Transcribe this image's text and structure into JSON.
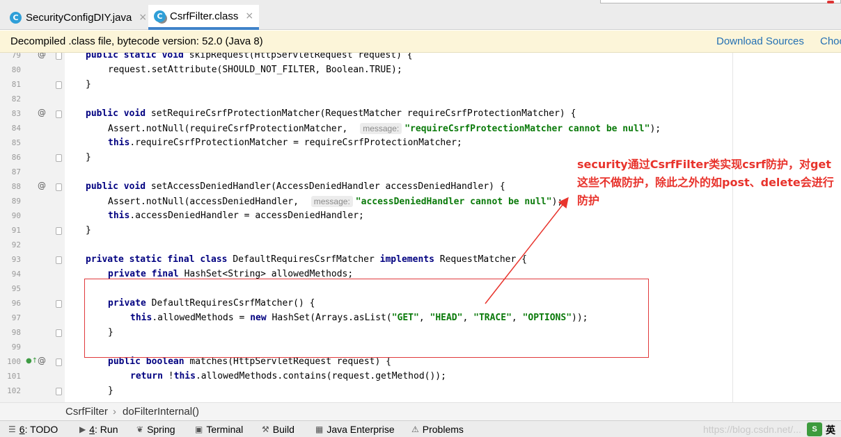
{
  "tabs": [
    {
      "icon": "class-icon",
      "label": "SecurityConfigDIY.java",
      "close": "×"
    },
    {
      "icon": "class-locked-icon",
      "label": "CsrfFilter.class",
      "close": "×"
    }
  ],
  "banner": {
    "message": "Decompiled .class file, bytecode version: 52.0 (Java 8)",
    "download_link": "Download Sources",
    "choose_link": "Choo"
  },
  "code": {
    "lines": [
      {
        "num": "79",
        "ann": "@",
        "fold": true,
        "indent": 1,
        "tokens": [
          [
            "kw",
            "public static void "
          ],
          [
            "",
            "skipRequest(HttpServletRequest request) {"
          ]
        ]
      },
      {
        "num": "80",
        "indent": 2,
        "tokens": [
          [
            "",
            "request.setAttribute(SHOULD_NOT_FILTER, Boolean.TRUE);"
          ]
        ]
      },
      {
        "num": "81",
        "fold": true,
        "indent": 1,
        "tokens": [
          [
            "",
            "}"
          ]
        ]
      },
      {
        "num": "82",
        "indent": 0,
        "tokens": []
      },
      {
        "num": "83",
        "ann": "@",
        "fold": true,
        "indent": 1,
        "tokens": [
          [
            "kw",
            "public void "
          ],
          [
            "",
            "setRequireCsrfProtectionMatcher(RequestMatcher requireCsrfProtectionMatcher) {"
          ]
        ]
      },
      {
        "num": "84",
        "indent": 2,
        "tokens": [
          [
            "",
            "Assert.notNull(requireCsrfProtectionMatcher, "
          ],
          [
            "hint",
            "message:"
          ],
          [
            "str",
            "\"requireCsrfProtectionMatcher cannot be null\""
          ],
          [
            "",
            ");"
          ]
        ]
      },
      {
        "num": "85",
        "indent": 2,
        "tokens": [
          [
            "kw",
            "this"
          ],
          [
            "",
            ".requireCsrfProtectionMatcher = requireCsrfProtectionMatcher;"
          ]
        ]
      },
      {
        "num": "86",
        "fold": true,
        "indent": 1,
        "tokens": [
          [
            "",
            "}"
          ]
        ]
      },
      {
        "num": "87",
        "indent": 0,
        "tokens": []
      },
      {
        "num": "88",
        "ann": "@",
        "fold": true,
        "indent": 1,
        "tokens": [
          [
            "kw",
            "public void "
          ],
          [
            "",
            "setAccessDeniedHandler(AccessDeniedHandler accessDeniedHandler) {"
          ]
        ]
      },
      {
        "num": "89",
        "indent": 2,
        "tokens": [
          [
            "",
            "Assert.notNull(accessDeniedHandler, "
          ],
          [
            "hint",
            "message:"
          ],
          [
            "str",
            "\"accessDeniedHandler cannot be null\""
          ],
          [
            "",
            ");"
          ]
        ]
      },
      {
        "num": "90",
        "indent": 2,
        "tokens": [
          [
            "kw",
            "this"
          ],
          [
            "",
            ".accessDeniedHandler = accessDeniedHandler;"
          ]
        ]
      },
      {
        "num": "91",
        "fold": true,
        "indent": 1,
        "tokens": [
          [
            "",
            "}"
          ]
        ]
      },
      {
        "num": "92",
        "indent": 0,
        "tokens": []
      },
      {
        "num": "93",
        "fold": true,
        "indent": 1,
        "tokens": [
          [
            "kw",
            "private static final class "
          ],
          [
            "",
            "DefaultRequiresCsrfMatcher "
          ],
          [
            "kw",
            "implements "
          ],
          [
            "",
            "RequestMatcher {"
          ]
        ]
      },
      {
        "num": "94",
        "indent": 2,
        "tokens": [
          [
            "kw",
            "private final "
          ],
          [
            "",
            "HashSet<String> allowedMethods;"
          ]
        ]
      },
      {
        "num": "95",
        "indent": 0,
        "tokens": []
      },
      {
        "num": "96",
        "fold": true,
        "indent": 2,
        "tokens": [
          [
            "kw",
            "private "
          ],
          [
            "",
            "DefaultRequiresCsrfMatcher() {"
          ]
        ]
      },
      {
        "num": "97",
        "indent": 3,
        "tokens": [
          [
            "kw",
            "this"
          ],
          [
            "",
            ".allowedMethods = "
          ],
          [
            "kw",
            "new "
          ],
          [
            "",
            "HashSet(Arrays.asList("
          ],
          [
            "str",
            "\"GET\""
          ],
          [
            "",
            ", "
          ],
          [
            "str",
            "\"HEAD\""
          ],
          [
            "",
            ", "
          ],
          [
            "str",
            "\"TRACE\""
          ],
          [
            "",
            ", "
          ],
          [
            "str",
            "\"OPTIONS\""
          ],
          [
            "",
            "));"
          ]
        ]
      },
      {
        "num": "98",
        "fold": true,
        "indent": 2,
        "tokens": [
          [
            "",
            "}"
          ]
        ]
      },
      {
        "num": "99",
        "indent": 0,
        "tokens": []
      },
      {
        "num": "100",
        "ann": "@",
        "ann2": "●↑",
        "fold": true,
        "indent": 2,
        "tokens": [
          [
            "kw",
            "public boolean "
          ],
          [
            "",
            "matches(HttpServletRequest request) {"
          ]
        ]
      },
      {
        "num": "101",
        "indent": 3,
        "tokens": [
          [
            "kw",
            "return "
          ],
          [
            "",
            "!"
          ],
          [
            "kw",
            "this"
          ],
          [
            "",
            ".allowedMethods.contains(request.getMethod());"
          ]
        ]
      },
      {
        "num": "102",
        "fold": true,
        "indent": 2,
        "tokens": [
          [
            "",
            "}"
          ]
        ]
      }
    ]
  },
  "annotation": {
    "note": "security通过CsrfFilter类实现csrf防护，对get这些不做防护，除此之外的如post、delete会进行防护",
    "color": "#e8332c"
  },
  "breadcrumb": {
    "items": [
      "CsrfFilter",
      "doFilterInternal()"
    ],
    "separator": "›"
  },
  "toolwindows": [
    {
      "icon": "todo-icon",
      "num": "6",
      "label": ": TODO"
    },
    {
      "icon": "run-icon",
      "num": "4",
      "label": ": Run"
    },
    {
      "icon": "spring-icon",
      "num": "",
      "label": "Spring"
    },
    {
      "icon": "terminal-icon",
      "num": "",
      "label": "Terminal"
    },
    {
      "icon": "build-icon",
      "num": "",
      "label": "Build"
    },
    {
      "icon": "java-enterprise-icon",
      "num": "",
      "label": "Java Enterprise"
    },
    {
      "icon": "problems-icon",
      "num": "",
      "label": "Problems"
    }
  ],
  "watermark": "https://blog.csdn.net/...",
  "ime": {
    "badge": "S",
    "label": "英"
  }
}
